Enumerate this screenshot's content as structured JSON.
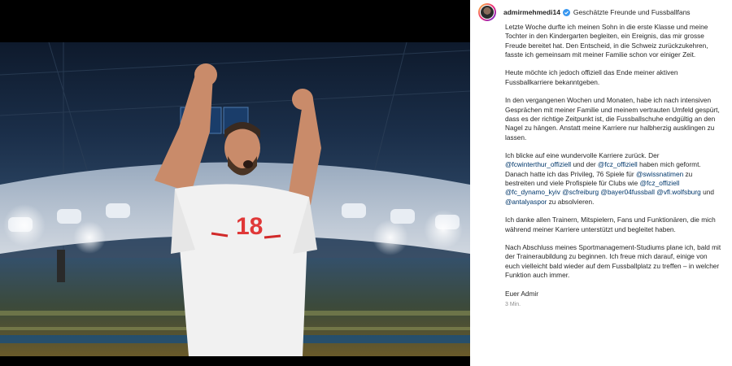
{
  "post": {
    "username": "admirmehmedi14",
    "caption_intro": "Geschätzte Freunde und Fussballfans",
    "time": "3 Min."
  },
  "jersey_number": "18",
  "caption": {
    "p1": "Letzte Woche durfte ich meinen Sohn in die erste Klasse und meine Tochter in den Kindergarten begleiten, ein Ereignis, das mir grosse Freude bereitet hat. Den Entscheid, in die Schweiz zurückzukehren, fasste ich gemeinsam mit meiner Familie schon vor einiger Zeit.",
    "p2": "Heute möchte ich jedoch offiziell das Ende meiner aktiven Fussballkarriere bekanntgeben.",
    "p3": "In den vergangenen Wochen und Monaten, habe ich nach intensiven Gesprächen mit meiner Familie und meinem vertrauten Umfeld gespürt, dass es der richtige Zeitpunkt ist, die Fussballschuhe endgültig an den Nagel zu hängen. Anstatt meine Karriere nur halbherzig ausklingen zu lassen.",
    "p4": {
      "t1": "Ich blicke auf eine wundervolle Karriere zurück. Der ",
      "m1": "@fcwinterthur_offiziell",
      "t2": " und der ",
      "m2": "@fcz_offiziell",
      "t3": " haben mich geformt. Danach hatte ich das Privileg, 76 Spiele für ",
      "m3": "@swissnatimen",
      "t4": " zu bestreiten und viele Profispiele für Clubs wie ",
      "m4": "@fcz_offiziell",
      "m5": "@fc_dynamo_kyiv",
      "m6": "@scfreiburg",
      "m7": "@bayer04fussball",
      "m8": "@vfl.wolfsburg",
      "t5": " und ",
      "m9": "@antalyaspor",
      "t6": " zu absolvieren."
    },
    "p5": "Ich danke allen Trainern, Mitspielern, Fans und Funktionären, die mich während meiner Karriere unterstützt und begleitet haben.",
    "p6": "Nach Abschluss meines Sportmanagement-Studiums plane ich, bald mit der Traineraubildung zu beginnen. Ich freue mich darauf, einige von euch vielleicht bald wieder auf dem Fussballplatz zu treffen – in welcher Funktion auch immer.",
    "sign": "Euer Admir"
  }
}
